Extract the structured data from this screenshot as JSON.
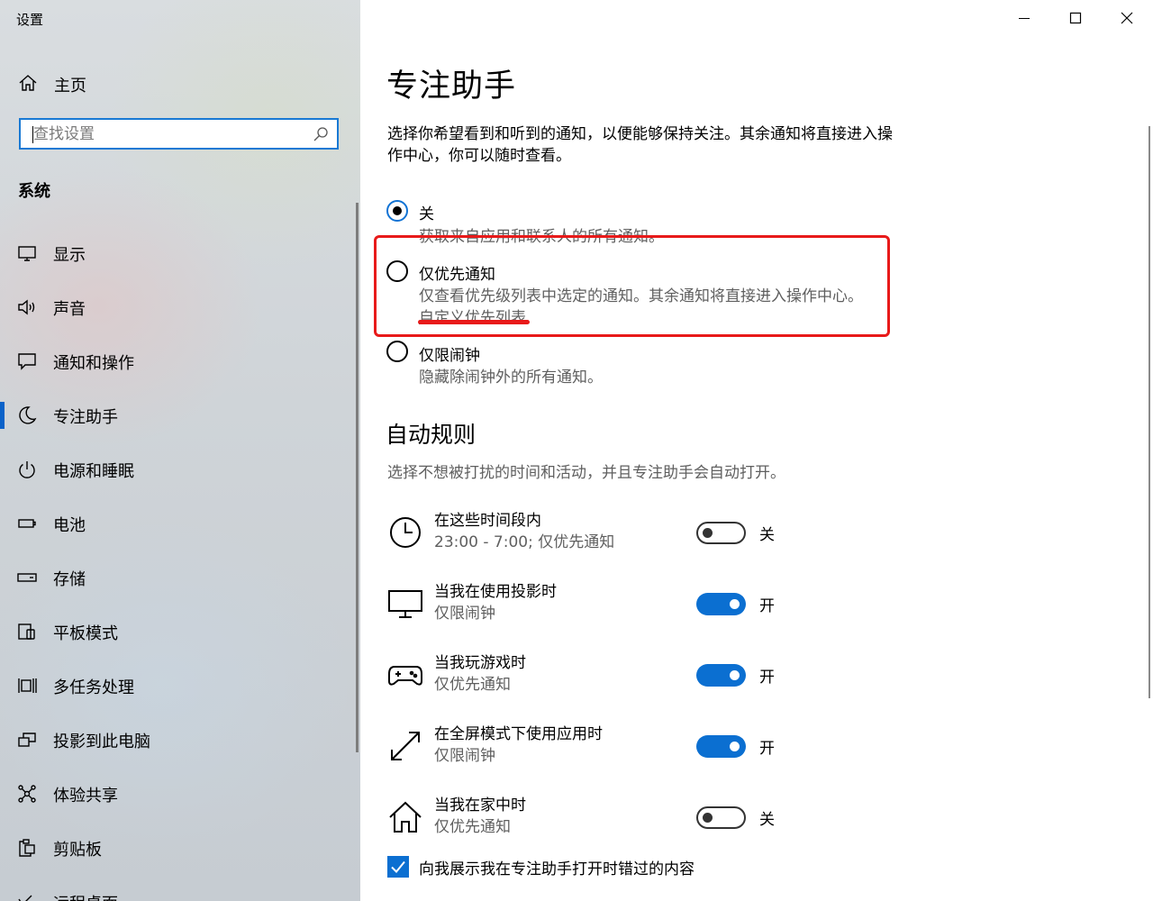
{
  "window": {
    "title": "设置"
  },
  "sidebar": {
    "home": "主页",
    "search_placeholder": "查找设置",
    "section": "系统",
    "items": [
      {
        "label": "显示",
        "icon": "monitor-icon"
      },
      {
        "label": "声音",
        "icon": "speaker-icon"
      },
      {
        "label": "通知和操作",
        "icon": "notification-icon"
      },
      {
        "label": "专注助手",
        "icon": "moon-icon",
        "active": true
      },
      {
        "label": "电源和睡眠",
        "icon": "power-icon"
      },
      {
        "label": "电池",
        "icon": "battery-icon"
      },
      {
        "label": "存储",
        "icon": "storage-icon"
      },
      {
        "label": "平板模式",
        "icon": "tablet-mode-icon"
      },
      {
        "label": "多任务处理",
        "icon": "multitasking-icon"
      },
      {
        "label": "投影到此电脑",
        "icon": "project-icon"
      },
      {
        "label": "体验共享",
        "icon": "share-icon"
      },
      {
        "label": "剪贴板",
        "icon": "clipboard-icon"
      },
      {
        "label": "远程桌面",
        "icon": "remote-desktop-icon"
      }
    ]
  },
  "main": {
    "title": "专注助手",
    "description": "选择你希望看到和听到的通知，以便能够保持关注。其余通知将直接进入操作中心，你可以随时查看。",
    "options": [
      {
        "label": "关",
        "desc": "获取来自应用和联系人的所有通知。",
        "checked": true
      },
      {
        "label": "仅优先通知",
        "desc": "仅查看优先级列表中选定的通知。其余通知将直接进入操作中心。",
        "link": "自定义优先列表",
        "checked": false
      },
      {
        "label": "仅限闹钟",
        "desc": "隐藏除闹钟外的所有通知。",
        "checked": false
      }
    ],
    "auto_rules": {
      "title": "自动规则",
      "desc": "选择不想被打扰的时间和活动，并且专注助手会自动打开。",
      "rules": [
        {
          "name": "在这些时间段内",
          "sub": "23:00 - 7:00; 仅优先通知",
          "on": false,
          "state": "关",
          "icon": "clock-icon"
        },
        {
          "name": "当我在使用投影时",
          "sub": "仅限闹钟",
          "on": true,
          "state": "开",
          "icon": "monitor-icon"
        },
        {
          "name": "当我玩游戏时",
          "sub": "仅优先通知",
          "on": true,
          "state": "开",
          "icon": "gamepad-icon"
        },
        {
          "name": "在全屏模式下使用应用时",
          "sub": "仅限闹钟",
          "on": true,
          "state": "开",
          "icon": "fullscreen-icon"
        },
        {
          "name": "当我在家中时",
          "sub": "仅优先通知",
          "on": false,
          "state": "关",
          "icon": "home-icon"
        }
      ]
    },
    "show_missed": {
      "label": "向我展示我在专注助手打开时错过的内容",
      "checked": true
    }
  },
  "colors": {
    "accent": "#0b6fd1",
    "highlight": "#e81a1a"
  }
}
